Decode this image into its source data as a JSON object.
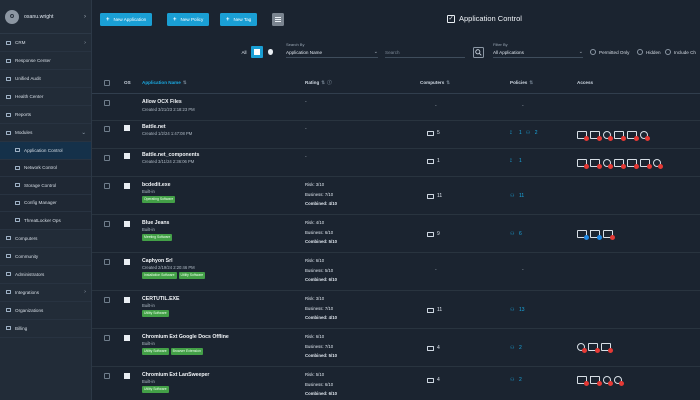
{
  "user": {
    "initial": "o",
    "name": "osanu.wright",
    "chevron": "›"
  },
  "sidebar": {
    "items": [
      {
        "label": "CRM",
        "icon": "crm-icon",
        "chevron": "›"
      },
      {
        "label": "Response Center",
        "icon": "response-icon"
      },
      {
        "label": "Unified Audit",
        "icon": "audit-icon"
      },
      {
        "label": "Health Center",
        "icon": "health-icon"
      },
      {
        "label": "Reports",
        "icon": "reports-icon"
      },
      {
        "label": "Modules",
        "icon": "modules-icon",
        "chevron": "⌄"
      },
      {
        "label": "Application Control",
        "icon": "app-control-icon"
      },
      {
        "label": "Network Control",
        "icon": "network-icon"
      },
      {
        "label": "Storage Control",
        "icon": "storage-icon"
      },
      {
        "label": "Config Manager",
        "icon": "config-icon"
      },
      {
        "label": "ThreatLocker Ops",
        "icon": "ops-icon"
      },
      {
        "label": "Computers",
        "icon": "computers-icon"
      },
      {
        "label": "Community",
        "icon": "community-icon"
      },
      {
        "label": "Administrators",
        "icon": "admins-icon"
      },
      {
        "label": "Integrations",
        "icon": "integrations-icon",
        "chevron": "›"
      },
      {
        "label": "Organizations",
        "icon": "org-icon"
      },
      {
        "label": "Billing",
        "icon": "billing-icon"
      }
    ]
  },
  "toolbar": {
    "new_application": "New Application",
    "new_policy": "New Policy",
    "new_tag": "New Tag",
    "plus": "+"
  },
  "page": {
    "title": "Application Control",
    "check": "✓"
  },
  "filters": {
    "os_all": "All",
    "search_by_label": "Search By",
    "search_by_value": "Application Name",
    "search_placeholder": "Search",
    "filter_by_label": "Filter By",
    "filter_by_value": "All Applications",
    "permitted_only": "Permitted Only",
    "hidden": "Hidden",
    "include_ch": "Include Ch",
    "arrow": "⌄"
  },
  "table": {
    "headers": {
      "os": "OS",
      "application_name": "Application Name",
      "rating": "Rating",
      "computers": "Computers",
      "policies": "Policies",
      "access": "Access",
      "sort": "⇅",
      "info": "ⓘ"
    },
    "rows": [
      {
        "name": "Allow OCX Files",
        "sub": "Created 3/21/23 2:18:23 PM",
        "tags": [],
        "rating": "-",
        "computers": "-",
        "policies": "-",
        "access": []
      },
      {
        "name": "Battle.net",
        "sub": "Created 1/2/24 1:47:08 PM",
        "tags": [],
        "rating": "-",
        "computers": "5",
        "policies": "1",
        "policies2": "2",
        "access": [
          "r",
          "r",
          "r",
          "r",
          "r",
          "r"
        ]
      },
      {
        "name": "Battle.net_components",
        "sub": "Created 3/11/24 2:36:06 PM",
        "tags": [],
        "rating": "-",
        "computers": "1",
        "policies": "1",
        "access": [
          "r",
          "r",
          "r",
          "r",
          "r",
          "r",
          "r"
        ]
      },
      {
        "name": "bcdedit.exe",
        "sub": "Built-in",
        "tags": [
          "Operating Software"
        ],
        "risk": "Risk: 3/10",
        "business": "Business: 7/10",
        "combined": "Combined: 4/10",
        "computers": "11",
        "policies": "11",
        "access": []
      },
      {
        "name": "Blue Jeans",
        "sub": "Built-in",
        "tags": [
          "Meeting Software"
        ],
        "risk": "Risk: 4/10",
        "business": "Business: 6/10",
        "combined": "Combined: 5/10",
        "computers": "9",
        "policies": "6",
        "access": [
          "b",
          "b",
          "r"
        ]
      },
      {
        "name": "Caphyon Srl",
        "sub": "Created 2/19/24 2:20:46 PM",
        "tags": [
          "Installation Software",
          "Utility Software"
        ],
        "risk": "Risk: 6/10",
        "business": "Business: 5/10",
        "combined": "Combined: 6/10",
        "computers": "-",
        "policies": "-",
        "access": []
      },
      {
        "name": "CERTUTIL.EXE",
        "sub": "Built-in",
        "tags": [
          "Utility Software"
        ],
        "risk": "Risk: 3/10",
        "business": "Business: 7/10",
        "combined": "Combined: 4/10",
        "computers": "11",
        "policies": "13",
        "access": []
      },
      {
        "name": "Chromium Ext Google Docs Offline",
        "sub": "Built-in",
        "tags": [
          "Utility Software",
          "Browser Extension"
        ],
        "risk": "Risk: 6/10",
        "business": "Business: 7/10",
        "combined": "Combined: 5/10",
        "computers": "4",
        "policies": "2",
        "access": [
          "r",
          "r",
          "r"
        ]
      },
      {
        "name": "Chromium Ext LanSweeper",
        "sub": "Built-in",
        "tags": [
          "Utility Software"
        ],
        "risk": "Risk: 5/10",
        "business": "Business: 6/10",
        "combined": "Combined: 6/10",
        "computers": "4",
        "policies": "2",
        "access": [
          "r",
          "r",
          "r",
          "r"
        ]
      }
    ]
  },
  "colors": {
    "accent": "#1a9fd4",
    "tag_green": "#43a047",
    "badge_red": "#e53935",
    "background": "#1b2430"
  }
}
